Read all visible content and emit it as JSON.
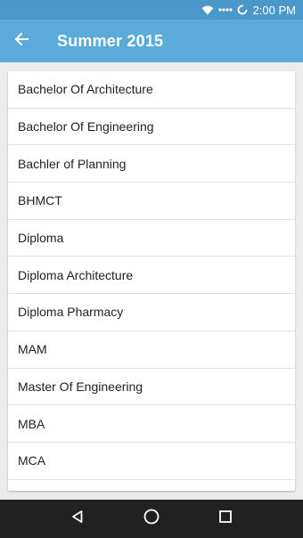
{
  "status_bar": {
    "time": "2:00 PM",
    "icons": [
      "wifi-icon",
      "signal-dots-icon",
      "loading-circle-icon"
    ]
  },
  "app_bar": {
    "title": "Summer 2015",
    "back_icon": "arrow-back-icon"
  },
  "courses": [
    {
      "label": "Bachelor Of Architecture"
    },
    {
      "label": "Bachelor Of Engineering"
    },
    {
      "label": "Bachler of Planning"
    },
    {
      "label": "BHMCT"
    },
    {
      "label": "Diploma"
    },
    {
      "label": "Diploma Architecture"
    },
    {
      "label": "Diploma Pharmacy"
    },
    {
      "label": "MAM"
    },
    {
      "label": "Master Of Engineering"
    },
    {
      "label": "MBA"
    },
    {
      "label": "MCA"
    },
    {
      "label": ""
    }
  ],
  "nav_bar": {
    "icons": [
      "back-triangle-icon",
      "home-circle-icon",
      "recents-square-icon"
    ]
  },
  "colors": {
    "status_bar": "#4a98c9",
    "app_bar": "#5aabd9",
    "background": "#ececec",
    "nav_bar": "#212121"
  }
}
